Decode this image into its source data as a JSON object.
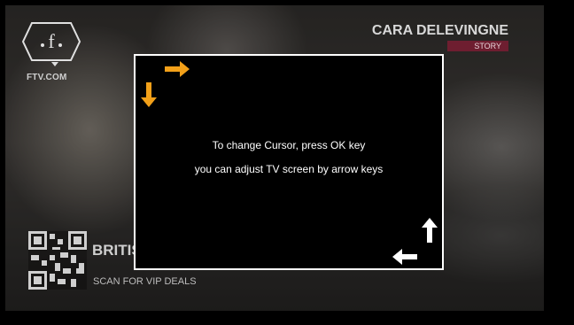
{
  "background": {
    "brand_subtitle": "FTV.COM",
    "celebrity_name": "CARA DELEVINGNE",
    "story_badge": "STORY",
    "ticker_partial": "BRITIS",
    "scan_label": "SCAN FOR VIP DEALS"
  },
  "dialog": {
    "line1": "To change Cursor, press OK key",
    "line2": "you can adjust TV screen by arrow keys"
  },
  "icons": {
    "top_right": "orange-arrow-right-icon",
    "top_down": "orange-arrow-down-icon",
    "bottom_up": "white-arrow-up-icon",
    "bottom_left": "white-arrow-left-icon"
  },
  "colors": {
    "accent_orange": "#f2a019",
    "border": "#ffffff",
    "story_badge": "#8f1430"
  }
}
